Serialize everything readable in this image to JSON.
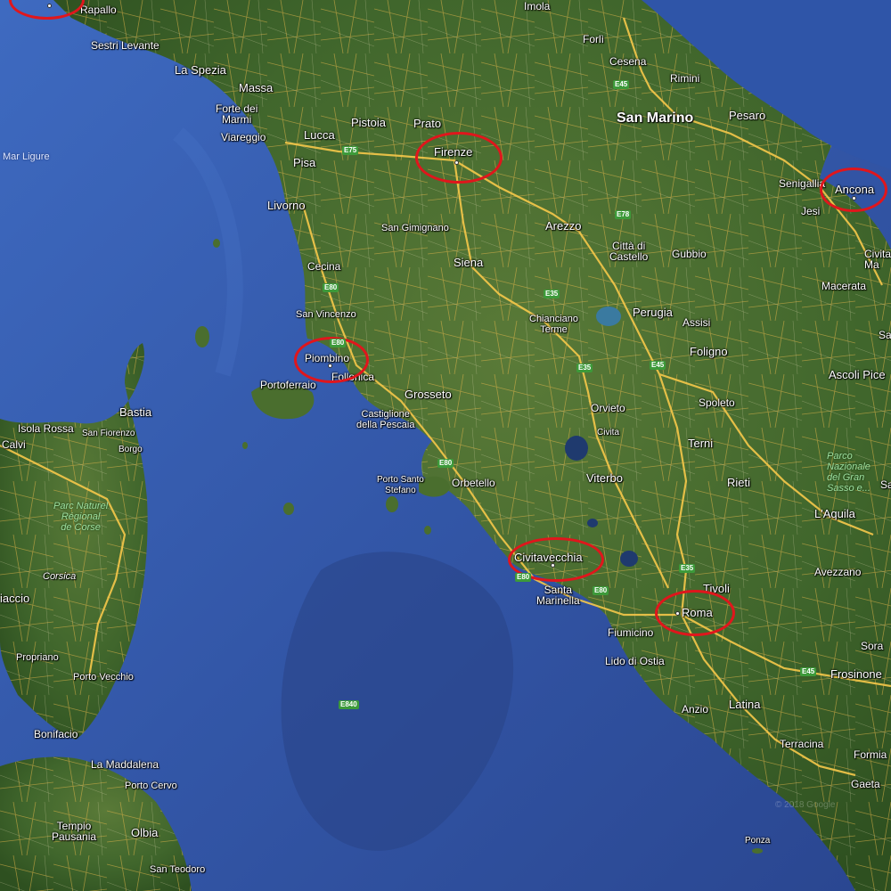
{
  "map": {
    "cities": {
      "rapallo": "Rapallo",
      "imola": "Imola",
      "forli": "Forlì",
      "cesena": "Cesena",
      "rimini": "Rimini",
      "sestri_levante": "Sestri Levante",
      "la_spezia": "La Spezia",
      "massa": "Massa",
      "forte_dei_marmi": "Forte dei\nMarmi",
      "viareggio": "Viareggio",
      "pistoia": "Pistoia",
      "prato": "Prato",
      "lucca": "Lucca",
      "pisa": "Pisa",
      "livorno": "Livorno",
      "san_gimignano": "San Gimignano",
      "cecina": "Cecina",
      "siena": "Siena",
      "arezzo": "Arezzo",
      "citta_di_castello": "Città di\nCastello",
      "gubbio": "Gubbio",
      "san_vincenzo": "San Vincenzo",
      "chianciano_terme": "Chianciano\nTerme",
      "perugia": "Perugia",
      "assisi": "Assisi",
      "foligno": "Foligno",
      "portoferraio": "Portoferraio",
      "follonica": "Follonica",
      "grosseto": "Grosseto",
      "castiglione": "Castiglione\ndella Pescaia",
      "orvieto": "Orvieto",
      "civita": "Civita",
      "spoleto": "Spoleto",
      "terni": "Terni",
      "porto_santo_stefano": "Porto Santo\nStefano",
      "orbetello": "Orbetello",
      "viterbo": "Viterbo",
      "rieti": "Rieti",
      "laquila": "L'Aquila",
      "santa_marinella": "Santa\nMarinella",
      "tivoli": "Tivoli",
      "avezzano": "Avezzano",
      "fiumicino": "Fiumicino",
      "lido_di_ostia": "Lido di Ostia",
      "sora": "Sora",
      "frosinone": "Frosinone",
      "anzio": "Anzio",
      "latina": "Latina",
      "terracina": "Terracina",
      "formia": "Formia",
      "gaeta": "Gaeta",
      "ponza": "Ponza",
      "senigallia": "Senigallia",
      "jesi": "Jesi",
      "civita_m": "Civita\nMa",
      "macerata": "Macerata",
      "ascoli": "Ascoli Pice",
      "pesaro": "Pesaro",
      "bastia": "Bastia",
      "isola_rossa": "Isola Rossa",
      "san_fiorenzo": "San Fiorenzo",
      "borgo": "Borgo",
      "calvi": "Calvi",
      "corsica": "Corsica",
      "aiaccio": "iaccio",
      "propriano": "Propriano",
      "porto_vecchio": "Porto Vecchio",
      "bonifacio": "Bonifacio",
      "la_maddalena": "La Maddalena",
      "porto_cervo": "Porto Cervo",
      "tempio": "Tempio\nPausania",
      "olbia": "Olbia",
      "san_teodoro": "San Teodoro",
      "sa": "Sa",
      "sa2": "Sa"
    },
    "highlighted": {
      "firenze": "Firenze",
      "ancona": "Ancona",
      "piombino": "Piombino",
      "civitavecchia": "Civitavecchia",
      "roma": "Roma"
    },
    "region": {
      "san_marino": "San Marino"
    },
    "sea": {
      "mar_ligure": "Mar Ligure"
    },
    "parks": {
      "corse": "Parc Naturel\nRégional\nde Corse",
      "gran_sasso": "Parco\nNazionale\ndel Gran\nSasso e..."
    },
    "roads": {
      "e45_n": "E45",
      "e75": "E75",
      "e78": "E78",
      "e80_a": "E80",
      "e80_b": "E80",
      "e35_a": "E35",
      "e35_b": "E35",
      "e45_c": "E45",
      "e80_c": "E80",
      "e80_d": "E80",
      "e35_c": "E35",
      "e45_s": "E45",
      "e840": "E840",
      "e80_e": "E80"
    },
    "watermark": "© 2018 Google"
  },
  "colors": {
    "sea_deep": "#2c4a8e",
    "sea_mid": "#3b63b8",
    "sea_shallow": "#5a82d2",
    "land_green": "#3f6a2a",
    "land_dark": "#2d4f1e",
    "road_yellow": "#f2c14e",
    "marker_red": "#e0161c"
  }
}
